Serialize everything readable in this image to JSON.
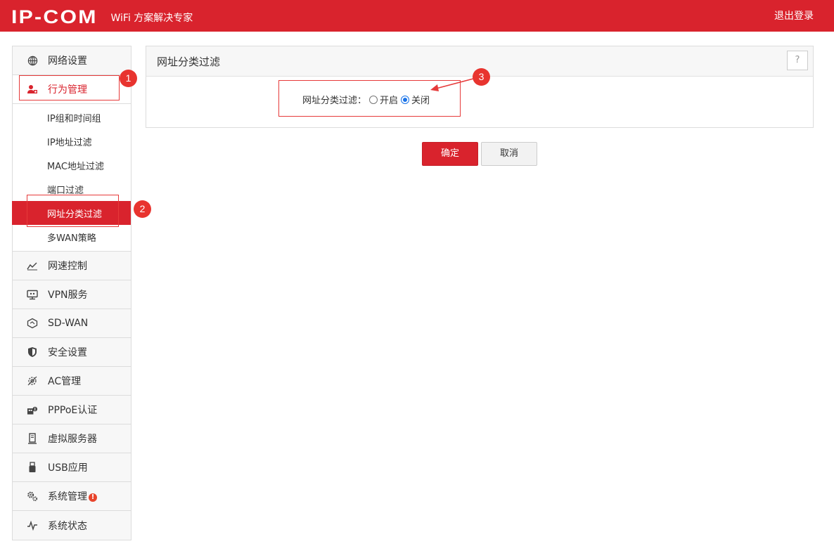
{
  "header": {
    "logo": "IP-COM",
    "tagline": "WiFi 方案解决专家",
    "logout_label": "退出登录"
  },
  "sidebar": {
    "items": [
      {
        "label": "网络设置",
        "icon": "globe-icon"
      },
      {
        "label": "行为管理",
        "icon": "user-manage-icon",
        "expanded": true
      },
      {
        "label": "网速控制",
        "icon": "speed-chart-icon"
      },
      {
        "label": "VPN服务",
        "icon": "vpn-monitor-icon"
      },
      {
        "label": "SD-WAN",
        "icon": "sdwan-icon"
      },
      {
        "label": "安全设置",
        "icon": "shield-icon"
      },
      {
        "label": "AC管理",
        "icon": "ac-manage-icon"
      },
      {
        "label": "PPPoE认证",
        "icon": "pppoe-icon"
      },
      {
        "label": "虚拟服务器",
        "icon": "server-icon"
      },
      {
        "label": "USB应用",
        "icon": "usb-icon"
      },
      {
        "label": "系统管理",
        "icon": "gears-icon",
        "badge": "!"
      },
      {
        "label": "系统状态",
        "icon": "pulse-icon"
      }
    ],
    "subitems": [
      {
        "label": "IP组和时间组"
      },
      {
        "label": "IP地址过滤"
      },
      {
        "label": "MAC地址过滤"
      },
      {
        "label": "端口过滤"
      },
      {
        "label": "网址分类过滤",
        "active": true
      },
      {
        "label": "多WAN策略"
      }
    ]
  },
  "panel": {
    "title": "网址分类过滤",
    "help": "?",
    "filter_label": "网址分类过滤：",
    "options": [
      {
        "label": "开启",
        "checked": false
      },
      {
        "label": "关闭",
        "checked": true
      }
    ]
  },
  "buttons": {
    "ok": "确定",
    "cancel": "取消"
  },
  "annotations": [
    "1",
    "2",
    "3"
  ],
  "colors": {
    "brand_red": "#d9232d",
    "annotation_red": "#e8342f",
    "radio_blue": "#1a73e8"
  }
}
